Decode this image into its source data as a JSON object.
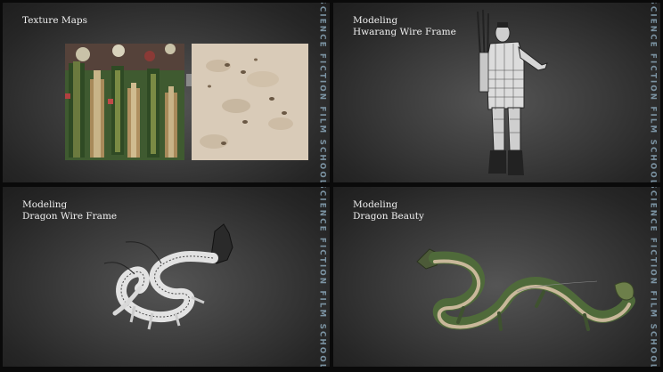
{
  "watermark": "SCIENCE FICTION FILM SCHOOL",
  "panels": [
    {
      "title": "Texture Maps",
      "subtitle": ""
    },
    {
      "title": "Modeling",
      "subtitle": "Hwarang Wire Frame"
    },
    {
      "title": "Modeling",
      "subtitle": "Dragon Wire Frame"
    },
    {
      "title": "Modeling",
      "subtitle": "Dragon Beauty"
    }
  ]
}
